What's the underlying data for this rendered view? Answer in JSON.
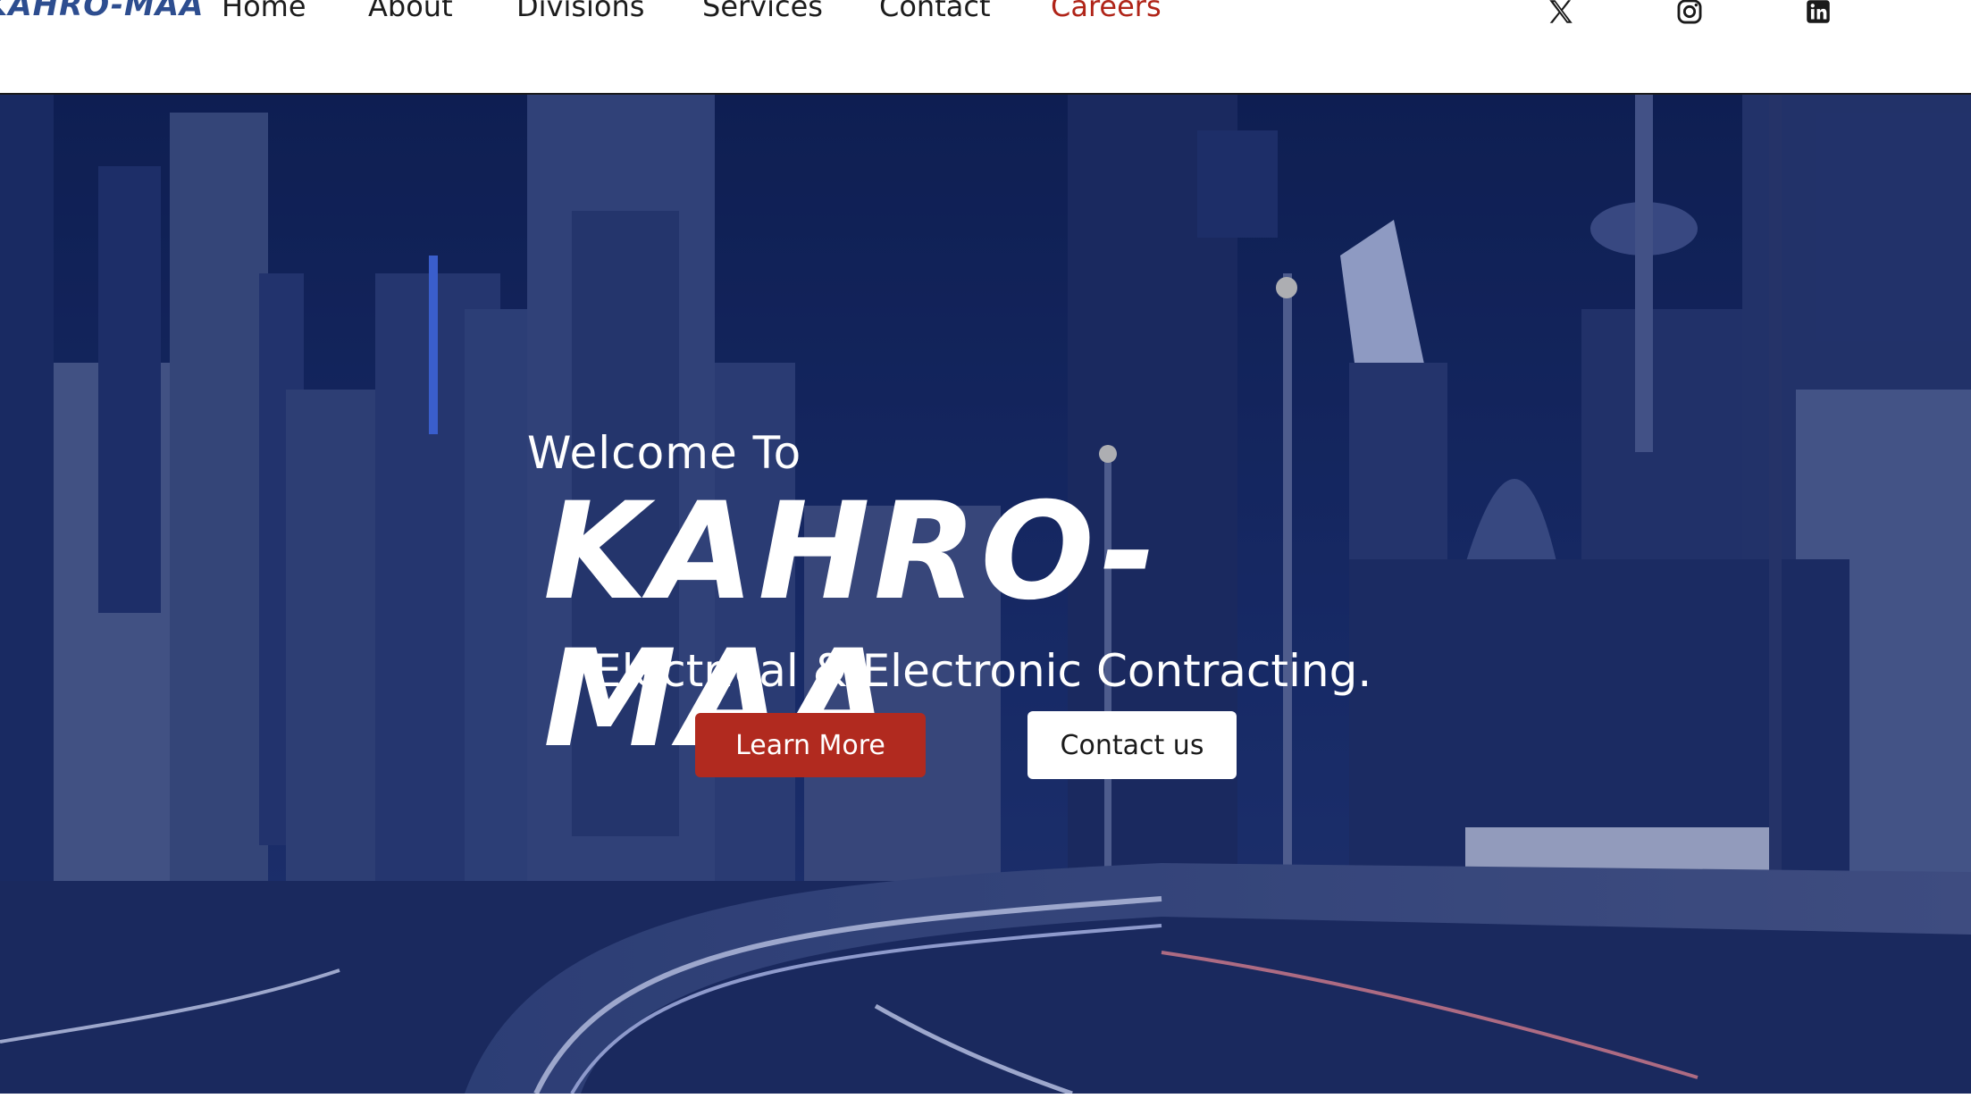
{
  "header": {
    "logo_text": "KAHRO-MAA",
    "nav": [
      {
        "label": "Home"
      },
      {
        "label": "About"
      },
      {
        "label": "Divisions"
      },
      {
        "label": "Services"
      },
      {
        "label": "Contact"
      },
      {
        "label": "Careers"
      }
    ],
    "social": [
      "x-icon",
      "instagram-icon",
      "linkedin-icon"
    ],
    "active_color": "#b02418"
  },
  "hero": {
    "welcome": "Welcome To",
    "brand": "KAHRO-MAA",
    "tagline": "Electrical & Electronic Contracting.",
    "primary_button": "Learn More",
    "secondary_button": "Contact us",
    "overlay_color": "#1a2d66",
    "primary_color": "#b12a1f"
  }
}
